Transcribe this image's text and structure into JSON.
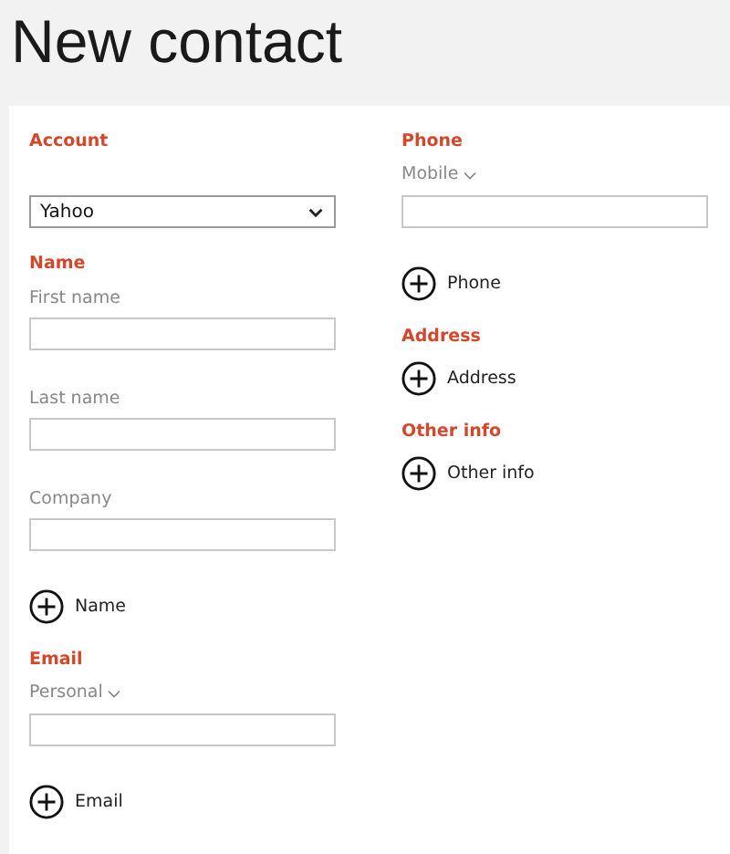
{
  "title": "New contact",
  "columns": [
    [
      {
        "heading": "Account",
        "items": [
          {
            "kind": "select",
            "value": "Yahoo"
          }
        ]
      },
      {
        "heading": "Name",
        "items": [
          {
            "kind": "label",
            "text": "First name"
          },
          {
            "kind": "input"
          },
          {
            "kind": "label",
            "text": "Last name"
          },
          {
            "kind": "input"
          },
          {
            "kind": "label",
            "text": "Company"
          },
          {
            "kind": "input"
          },
          {
            "kind": "add",
            "text": "Name"
          }
        ]
      },
      {
        "heading": "Email",
        "items": [
          {
            "kind": "picker",
            "text": "Personal"
          },
          {
            "kind": "input"
          },
          {
            "kind": "add",
            "text": "Email"
          }
        ]
      }
    ],
    [
      {
        "heading": "Phone",
        "items": [
          {
            "kind": "picker",
            "text": "Mobile"
          },
          {
            "kind": "input"
          },
          {
            "kind": "add",
            "text": "Phone"
          }
        ]
      },
      {
        "heading": "Address",
        "items": [
          {
            "kind": "add",
            "text": "Address"
          }
        ]
      },
      {
        "heading": "Other info",
        "items": [
          {
            "kind": "add",
            "text": "Other info"
          }
        ]
      }
    ]
  ]
}
